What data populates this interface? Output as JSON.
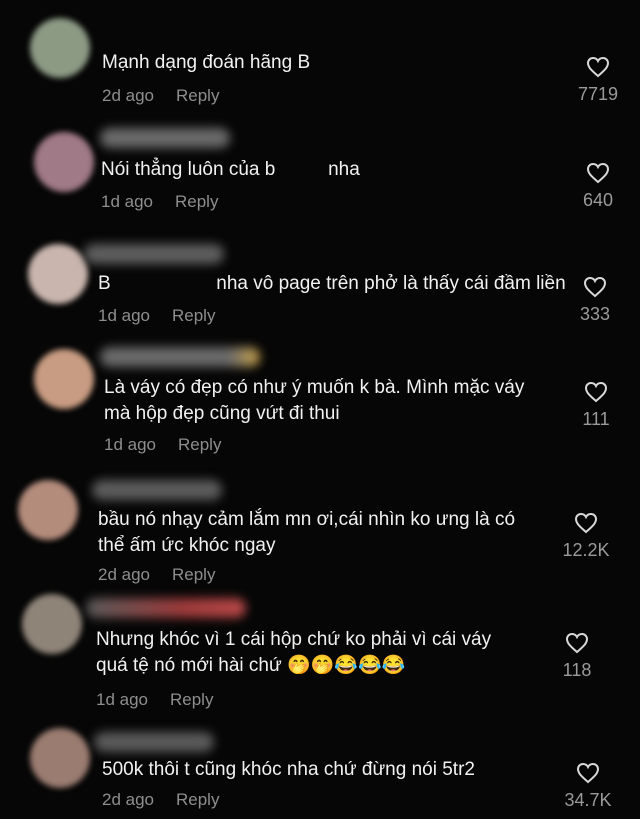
{
  "comments": [
    {
      "text": "Mạnh dạng đoán hãng B",
      "time": "2d ago",
      "reply": "Reply",
      "likes": "7719",
      "avatar_color": "#8c9a84"
    },
    {
      "text": "Nói thẳng luôn của b          nha",
      "time": "1d ago",
      "reply": "Reply",
      "likes": "640",
      "avatar_color": "#a07a86"
    },
    {
      "text": "B                    nha vô page trên phở là thấy cái đầm liền",
      "time": "1d ago",
      "reply": "Reply",
      "likes": "333",
      "avatar_color": "#c9b5ad"
    },
    {
      "text": "Là váy có đẹp có như ý muốn k bà. Mình mặc váy\nmà hộp đẹp cũng vứt đi thui",
      "time": "1d ago",
      "reply": "Reply",
      "likes": "111",
      "avatar_color": "#c89c82"
    },
    {
      "text": "bầu nó nhạy cảm lắm mn ơi,cái nhìn ko ưng là có\nthể ấm ức khóc ngay",
      "time": "2d ago",
      "reply": "Reply",
      "likes": "12.2K",
      "avatar_color": "#b48c7c"
    },
    {
      "text": "Nhưng khóc vì 1 cái hộp chứ ko phải vì cái váy\nquá tệ nó mới hài chứ 🤭🤭😂😂😂",
      "time": "1d ago",
      "reply": "Reply",
      "likes": "118",
      "avatar_color": "#8f8478"
    },
    {
      "text": "500k thôi t cũng khóc nha chứ đừng nói 5tr2",
      "time": "2d ago",
      "reply": "Reply",
      "likes": "34.7K",
      "avatar_color": "#9a7c70"
    }
  ],
  "icons": {
    "like": "heart-outline-icon"
  }
}
